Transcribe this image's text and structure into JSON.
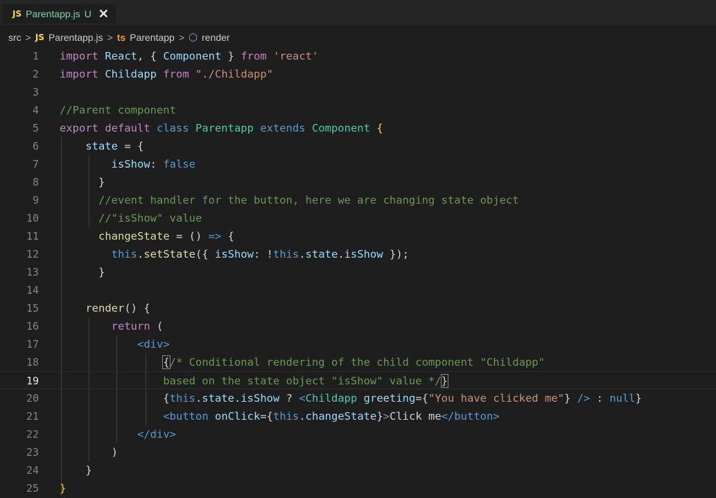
{
  "tab": {
    "badge": "JS",
    "filename": "Parentapp.js",
    "status": "U",
    "close": "✕"
  },
  "breadcrumb": {
    "sep": ">",
    "folder": "src",
    "file_badge": "JS",
    "file": "Parentapp.js",
    "class_icon": "ts",
    "class_name": "Parentapp",
    "method_icon": "⬡",
    "method_name": "render"
  },
  "editor": {
    "active_line": 19,
    "lines": [
      [
        {
          "t": "import ",
          "c": "kw"
        },
        {
          "t": "React",
          "c": "vr"
        },
        {
          "t": ", { "
        },
        {
          "t": "Component",
          "c": "vr"
        },
        {
          "t": " } "
        },
        {
          "t": "from ",
          "c": "kw"
        },
        {
          "t": "'react'",
          "c": "st"
        }
      ],
      [
        {
          "t": "import ",
          "c": "kw"
        },
        {
          "t": "Childapp",
          "c": "vr"
        },
        {
          "t": " "
        },
        {
          "t": "from ",
          "c": "kw"
        },
        {
          "t": "\"./Childapp\"",
          "c": "st"
        }
      ],
      [],
      [
        {
          "t": "//Parent component",
          "c": "cm"
        }
      ],
      [
        {
          "t": "export default ",
          "c": "kw"
        },
        {
          "t": "class ",
          "c": "bl"
        },
        {
          "t": "Parentapp",
          "c": "cls"
        },
        {
          "t": " extends ",
          "c": "bl"
        },
        {
          "t": "Component",
          "c": "cls"
        },
        {
          "t": " {",
          "c": "br"
        }
      ],
      [
        {
          "t": "    "
        },
        {
          "t": "state",
          "c": "vr"
        },
        {
          "t": " = {"
        }
      ],
      [
        {
          "t": "        "
        },
        {
          "t": "isShow",
          "c": "vr"
        },
        {
          "t": ": "
        },
        {
          "t": "false",
          "c": "bl"
        }
      ],
      [
        {
          "t": "      }"
        }
      ],
      [
        {
          "t": "      "
        },
        {
          "t": "//event handler for the button, here we are changing state object",
          "c": "cm"
        }
      ],
      [
        {
          "t": "      "
        },
        {
          "t": "//\"isShow\" value",
          "c": "cm"
        }
      ],
      [
        {
          "t": "      "
        },
        {
          "t": "changeState",
          "c": "fn"
        },
        {
          "t": " = () "
        },
        {
          "t": "=>",
          "c": "bl"
        },
        {
          "t": " {"
        }
      ],
      [
        {
          "t": "        "
        },
        {
          "t": "this",
          "c": "bl"
        },
        {
          "t": "."
        },
        {
          "t": "setState",
          "c": "fn"
        },
        {
          "t": "({ "
        },
        {
          "t": "isShow",
          "c": "vr"
        },
        {
          "t": ": !"
        },
        {
          "t": "this",
          "c": "bl"
        },
        {
          "t": "."
        },
        {
          "t": "state",
          "c": "vr"
        },
        {
          "t": "."
        },
        {
          "t": "isShow",
          "c": "vr"
        },
        {
          "t": " });"
        }
      ],
      [
        {
          "t": "      }"
        }
      ],
      [],
      [
        {
          "t": "    "
        },
        {
          "t": "render",
          "c": "fn"
        },
        {
          "t": "() {"
        }
      ],
      [
        {
          "t": "        "
        },
        {
          "t": "return",
          "c": "kw"
        },
        {
          "t": " ("
        }
      ],
      [
        {
          "t": "            "
        },
        {
          "t": "<",
          "c": "tg"
        },
        {
          "t": "div",
          "c": "tg"
        },
        {
          "t": ">",
          "c": "tg"
        }
      ],
      [
        {
          "t": "                "
        },
        {
          "t": "{",
          "c": "brm"
        },
        {
          "t": "/* Conditional rendering of the child component \"Childapp\"",
          "c": "cm"
        }
      ],
      [
        {
          "t": "                "
        },
        {
          "t": "based on the state object \"isShow\" value */",
          "c": "cm"
        },
        {
          "t": "}",
          "c": "brm"
        }
      ],
      [
        {
          "t": "                {"
        },
        {
          "t": "this",
          "c": "bl"
        },
        {
          "t": "."
        },
        {
          "t": "state",
          "c": "vr"
        },
        {
          "t": "."
        },
        {
          "t": "isShow",
          "c": "vr"
        },
        {
          "t": " ? "
        },
        {
          "t": "<",
          "c": "tg"
        },
        {
          "t": "Childapp",
          "c": "cls"
        },
        {
          "t": " "
        },
        {
          "t": "greeting",
          "c": "vr"
        },
        {
          "t": "={"
        },
        {
          "t": "\"You have clicked me\"",
          "c": "st"
        },
        {
          "t": "} "
        },
        {
          "t": "/>",
          "c": "tg"
        },
        {
          "t": " : "
        },
        {
          "t": "null",
          "c": "bl"
        },
        {
          "t": "}"
        }
      ],
      [
        {
          "t": "                "
        },
        {
          "t": "<",
          "c": "tg"
        },
        {
          "t": "button",
          "c": "tg"
        },
        {
          "t": " "
        },
        {
          "t": "onClick",
          "c": "vr"
        },
        {
          "t": "={"
        },
        {
          "t": "this",
          "c": "bl"
        },
        {
          "t": "."
        },
        {
          "t": "changeState",
          "c": "vr"
        },
        {
          "t": "}"
        },
        {
          "t": ">",
          "c": "tg"
        },
        {
          "t": "Click me"
        },
        {
          "t": "</",
          "c": "tg"
        },
        {
          "t": "button",
          "c": "tg"
        },
        {
          "t": ">",
          "c": "tg"
        }
      ],
      [
        {
          "t": "            "
        },
        {
          "t": "</",
          "c": "tg"
        },
        {
          "t": "div",
          "c": "tg"
        },
        {
          "t": ">",
          "c": "tg"
        }
      ],
      [
        {
          "t": "        )"
        }
      ],
      [
        {
          "t": "    }"
        }
      ],
      [
        {
          "t": "}",
          "c": "br"
        }
      ]
    ]
  }
}
